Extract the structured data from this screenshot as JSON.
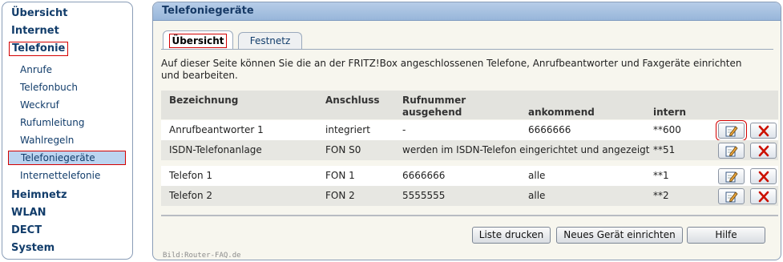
{
  "sidebar": {
    "sections": {
      "uebersicht": "Übersicht",
      "internet": "Internet",
      "telefonie": "Telefonie",
      "heimnetz": "Heimnetz",
      "wlan": "WLAN",
      "dect": "DECT",
      "system": "System"
    },
    "telefonie_items": [
      "Anrufe",
      "Telefonbuch",
      "Weckruf",
      "Rufumleitung",
      "Wahlregeln",
      "Telefoniegeräte",
      "Internettelefonie"
    ]
  },
  "main": {
    "title": "Telefoniegeräte",
    "tabs": [
      "Übersicht",
      "Festnetz"
    ],
    "description": "Auf dieser Seite können Sie die an der FRITZ!Box angeschlossenen Telefone, Anrufbeantworter und Faxgeräte einrichten und bearbeiten.",
    "table": {
      "headers": {
        "bezeichnung": "Bezeichnung",
        "anschluss": "Anschluss",
        "rufnummer": "Rufnummer",
        "ausgehend": "ausgehend",
        "ankommend": "ankommend",
        "intern": "intern"
      },
      "rows": [
        {
          "name": "Anrufbeantworter 1",
          "anschluss": "integriert",
          "ausgehend": "-",
          "ankommend": "6666666",
          "intern": "**600"
        },
        {
          "name": "ISDN-Telefonanlage",
          "anschluss": "FON S0",
          "ausgehend": "werden im ISDN-Telefon eingerichtet und angezeigt",
          "ankommend": "",
          "intern": "**51"
        },
        {
          "name": "Telefon 1",
          "anschluss": "FON 1",
          "ausgehend": "6666666",
          "ankommend": "alle",
          "intern": "**1"
        },
        {
          "name": "Telefon 2",
          "anschluss": "FON 2",
          "ausgehend": "5555555",
          "ankommend": "alle",
          "intern": "**2"
        }
      ]
    },
    "buttons": {
      "print": "Liste drucken",
      "new_device": "Neues Gerät einrichten",
      "help": "Hilfe"
    },
    "credit": "Bild:Router-FAQ.de"
  },
  "colors": {
    "accent_red": "#d40000",
    "nav_text": "#123d6b",
    "header_blue": "#a8c2e2",
    "panel_bg": "#f7f6ee",
    "delete_x": "#cc1100"
  },
  "icons": [
    "edit-icon",
    "delete-icon"
  ]
}
